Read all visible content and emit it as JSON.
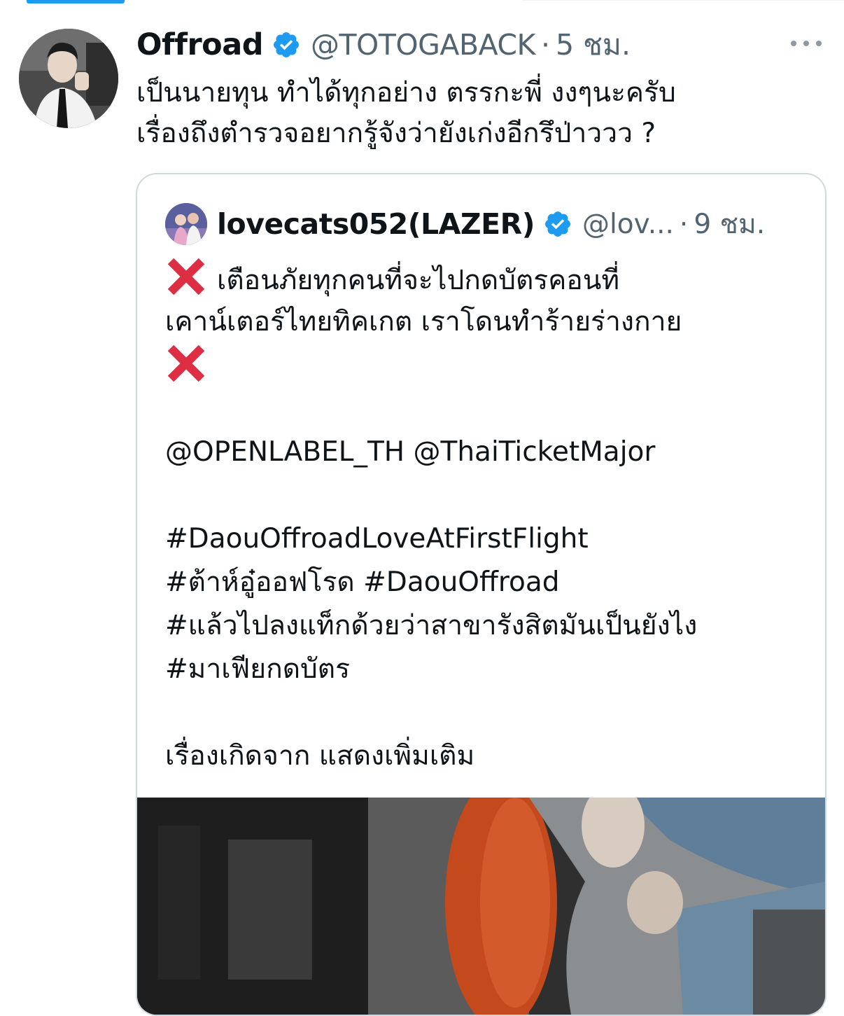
{
  "tweet": {
    "author_name": "Offroad",
    "author_handle": "@TOTOGABACK",
    "separator": "·",
    "time": "5 ชม.",
    "text_lines": [
      "เป็นนายทุน ทำได้ทุกอย่าง ตรรกะพี่ งงๆนะครับ",
      "เรื่องถึงตำรวจอยากรู้จังว่ายังเก่งอีกรึป่าววว ?"
    ],
    "verified_icon": "verified-badge-icon",
    "more_icon": "more-horizontal-icon"
  },
  "quote": {
    "author_name": "lovecats052(LAZER)",
    "author_handle": "@lov...",
    "separator": "·",
    "time": "9 ชม.",
    "line1": "เตือนภัยทุกคนที่จะไปกดบัตรคอนที่",
    "line2": "เคาน์เตอร์ไทยทิคเกต เราโดนทำร้ายร่างกาย",
    "mentions": "@OPENLABEL_TH @ThaiTicketMajor",
    "hashtag_lines": [
      "#DaouOffroadLoveAtFirstFlight",
      "#ต้าห์อู๋ออฟโรด #DaouOffroad",
      "#แล้วไปลงแท็กด้วยว่าสาขารังสิตมันเป็นยังไง",
      "#มาเฟียกดบัตร"
    ],
    "footer": "เรื่องเกิดจาก แสดงเพิ่มเติม",
    "warning_icon": "red-x-icon"
  },
  "colors": {
    "accent": "#1d9bf0",
    "secondary_text": "#536471",
    "border": "#cfd9de",
    "warning": "#dd2e44"
  }
}
